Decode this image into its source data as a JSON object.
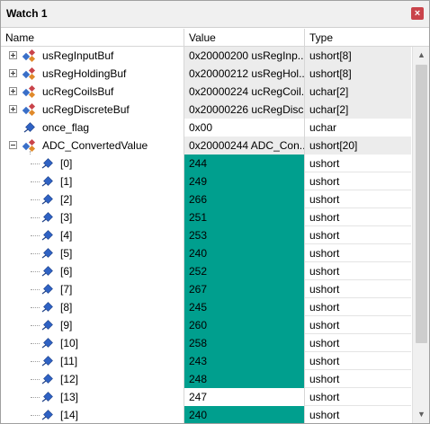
{
  "window": {
    "title": "Watch 1",
    "close_glyph": "×"
  },
  "columns": {
    "name": "Name",
    "value": "Value",
    "type": "Type"
  },
  "rows": [
    {
      "name": "usRegInputBuf",
      "value": "0x20000200 usRegInp...",
      "type": "ushort[8]",
      "expander": "plus",
      "icon": "struct-var-icon"
    },
    {
      "name": "usRegHoldingBuf",
      "value": "0x20000212 usRegHol...",
      "type": "ushort[8]",
      "expander": "plus",
      "icon": "struct-var-icon"
    },
    {
      "name": "ucRegCoilsBuf",
      "value": "0x20000224 ucRegCoil...",
      "type": "uchar[2]",
      "expander": "plus",
      "icon": "struct-var-icon"
    },
    {
      "name": "ucRegDiscreteBuf",
      "value": "0x20000226 ucRegDisc...",
      "type": "uchar[2]",
      "expander": "plus",
      "icon": "struct-var-icon"
    },
    {
      "name": "once_flag",
      "value": "0x00",
      "type": "uchar",
      "expander": "none",
      "icon": "variable-icon"
    },
    {
      "name": "ADC_ConvertedValue",
      "value": "0x20000244 ADC_Con...",
      "type": "ushort[20]",
      "expander": "minus",
      "icon": "struct-var-icon"
    }
  ],
  "adc_elements": [
    {
      "name": "[0]",
      "value": "244",
      "type": "ushort",
      "changed": true
    },
    {
      "name": "[1]",
      "value": "249",
      "type": "ushort",
      "changed": true
    },
    {
      "name": "[2]",
      "value": "266",
      "type": "ushort",
      "changed": true
    },
    {
      "name": "[3]",
      "value": "251",
      "type": "ushort",
      "changed": true
    },
    {
      "name": "[4]",
      "value": "253",
      "type": "ushort",
      "changed": true
    },
    {
      "name": "[5]",
      "value": "240",
      "type": "ushort",
      "changed": true
    },
    {
      "name": "[6]",
      "value": "252",
      "type": "ushort",
      "changed": true
    },
    {
      "name": "[7]",
      "value": "267",
      "type": "ushort",
      "changed": true
    },
    {
      "name": "[8]",
      "value": "245",
      "type": "ushort",
      "changed": true
    },
    {
      "name": "[9]",
      "value": "260",
      "type": "ushort",
      "changed": true
    },
    {
      "name": "[10]",
      "value": "258",
      "type": "ushort",
      "changed": true
    },
    {
      "name": "[11]",
      "value": "243",
      "type": "ushort",
      "changed": true
    },
    {
      "name": "[12]",
      "value": "248",
      "type": "ushort",
      "changed": true
    },
    {
      "name": "[13]",
      "value": "247",
      "type": "ushort",
      "changed": false
    },
    {
      "name": "[14]",
      "value": "240",
      "type": "ushort",
      "changed": true
    }
  ],
  "colors": {
    "changed_value_bg": "#009f8e",
    "static_value_bg": "#ececec"
  },
  "scrollbar": {
    "up_glyph": "▲",
    "down_glyph": "▼"
  }
}
